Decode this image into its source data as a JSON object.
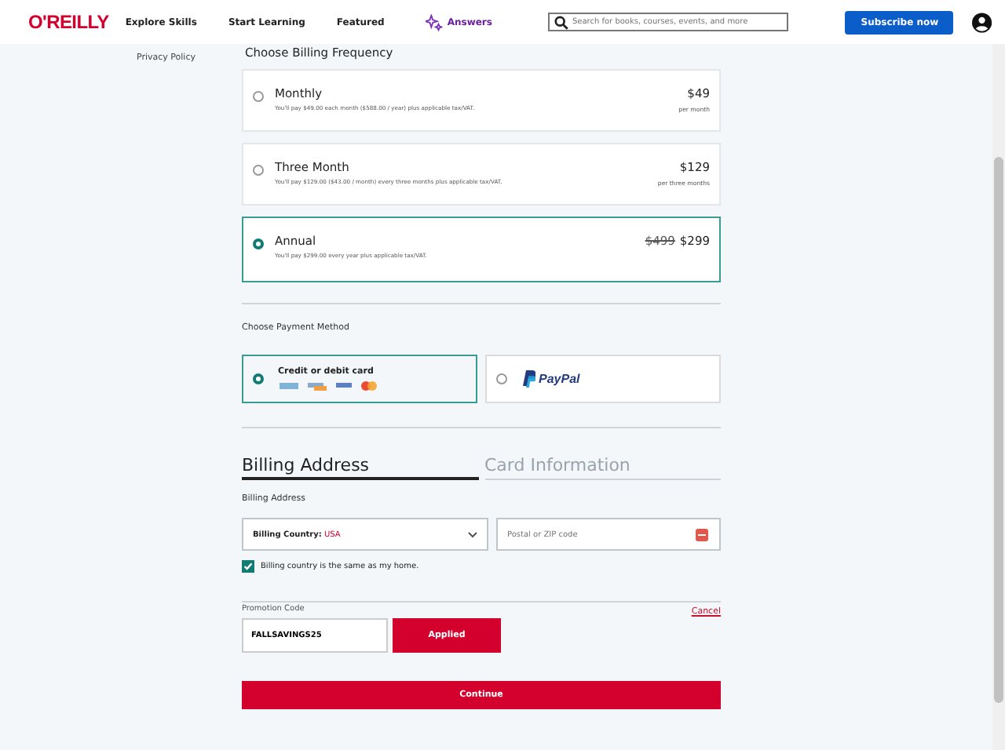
{
  "header": {
    "logo": "O'REILLY",
    "nav": [
      {
        "label": "Explore Skills",
        "kind": "plain"
      },
      {
        "label": "Start Learning",
        "kind": "plain"
      },
      {
        "label": "Featured",
        "kind": "plain"
      },
      {
        "label": "Answers",
        "kind": "answers"
      }
    ],
    "search": {
      "placeholder": "Search for books, courses, events, and more"
    },
    "subscribe": "Subscribe now"
  },
  "sidebar": {
    "link": "Privacy Policy"
  },
  "billing_frequency": {
    "heading": "Choose Billing Frequency",
    "plans": [
      {
        "name": "Monthly",
        "detail": "You'll pay $49.00 each month ($588.00 / year) plus applicable tax/VAT.",
        "price": "$49",
        "period": "per month",
        "selected": false
      },
      {
        "name": "Three Month",
        "detail": "You'll pay $129.00 ($43.00 / month) every three months plus applicable tax/VAT.",
        "price": "$129",
        "period": "per three months",
        "selected": false
      },
      {
        "name": "Annual",
        "detail": "You'll pay $299.00 every year plus applicable tax/VAT.",
        "old_price": "$499",
        "price": "$299",
        "selected": true
      }
    ]
  },
  "payment": {
    "heading": "Choose Payment Method",
    "methods": [
      {
        "kind": "card",
        "label": "Credit or debit card",
        "selected": true
      },
      {
        "kind": "paypal",
        "label": "PayPal",
        "selected": false
      }
    ]
  },
  "tabs": [
    {
      "label": "Billing Address",
      "selected": true
    },
    {
      "label": "Card Information",
      "selected": false
    }
  ],
  "address": {
    "heading": "Billing Address",
    "country_label": "Billing Country:",
    "country": "USA",
    "zip_placeholder": "Postal or ZIP code",
    "same_as_home": {
      "label": "Billing country is the same as my home.",
      "checked": true
    }
  },
  "promo": {
    "label": "Promotion Code",
    "cancel": "Cancel",
    "value": "FALLSAVINGS25",
    "applied": "Applied"
  },
  "continue": "Continue"
}
